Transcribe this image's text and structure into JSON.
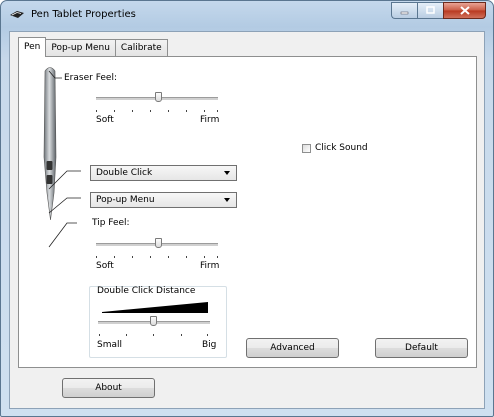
{
  "window": {
    "title": "Pen Tablet Properties"
  },
  "tabs": [
    {
      "label": "Pen"
    },
    {
      "label": "Pop-up Menu"
    },
    {
      "label": "Calibrate"
    }
  ],
  "eraser_feel": {
    "label": "Eraser Feel:",
    "min_label": "Soft",
    "max_label": "Firm",
    "value": 0.5
  },
  "tip_feel": {
    "label": "Tip Feel:",
    "min_label": "Soft",
    "max_label": "Firm",
    "value": 0.5
  },
  "upper_side_button": {
    "selected": "Double Click"
  },
  "lower_side_button": {
    "selected": "Pop-up Menu"
  },
  "click_sound": {
    "label": "Click Sound",
    "checked": false
  },
  "double_click_distance": {
    "title": "Double Click Distance",
    "min_label": "Small",
    "max_label": "Big",
    "value": 0.5
  },
  "buttons": {
    "advanced": "Advanced",
    "default": "Default",
    "about": "About"
  },
  "icons": {
    "app": "pen-tablet-icon",
    "minimize": "minimize-icon",
    "maximize": "maximize-icon",
    "close": "close-icon"
  },
  "colors": {
    "title_bar": "#b9cfe6",
    "close_button": "#c95a44",
    "panel": "#ffffff"
  }
}
